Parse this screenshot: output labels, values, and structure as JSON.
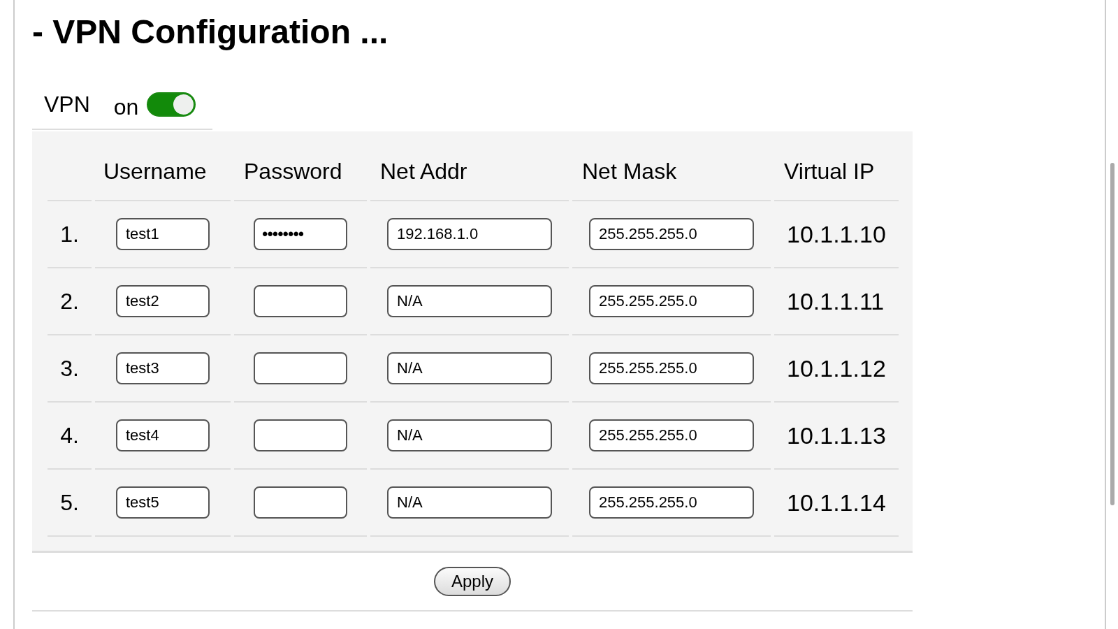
{
  "title": "- VPN Configuration ...",
  "vpn": {
    "label": "VPN",
    "state_label": "on",
    "on": true
  },
  "table": {
    "columns": [
      "Username",
      "Password",
      "Net Addr",
      "Net Mask",
      "Virtual IP"
    ],
    "rows": [
      {
        "number": "1.",
        "username": "test1",
        "password": "••••••••",
        "net_addr": "192.168.1.0",
        "net_mask": "255.255.255.0",
        "virtual_ip": "10.1.1.10"
      },
      {
        "number": "2.",
        "username": "test2",
        "net_addr": "N/A",
        "net_mask": "255.255.255.0",
        "virtual_ip": "10.1.1.11"
      },
      {
        "number": "3.",
        "username": "test3",
        "net_addr": "N/A",
        "net_mask": "255.255.255.0",
        "virtual_ip": "10.1.1.12"
      },
      {
        "number": "4.",
        "username": "test4",
        "net_addr": "N/A",
        "net_mask": "255.255.255.0",
        "virtual_ip": "10.1.1.13"
      },
      {
        "number": "5.",
        "username": "test5",
        "net_addr": "N/A",
        "net_mask": "255.255.255.0",
        "virtual_ip": "10.1.1.14"
      }
    ]
  },
  "buttons": [
    "Apply"
  ]
}
